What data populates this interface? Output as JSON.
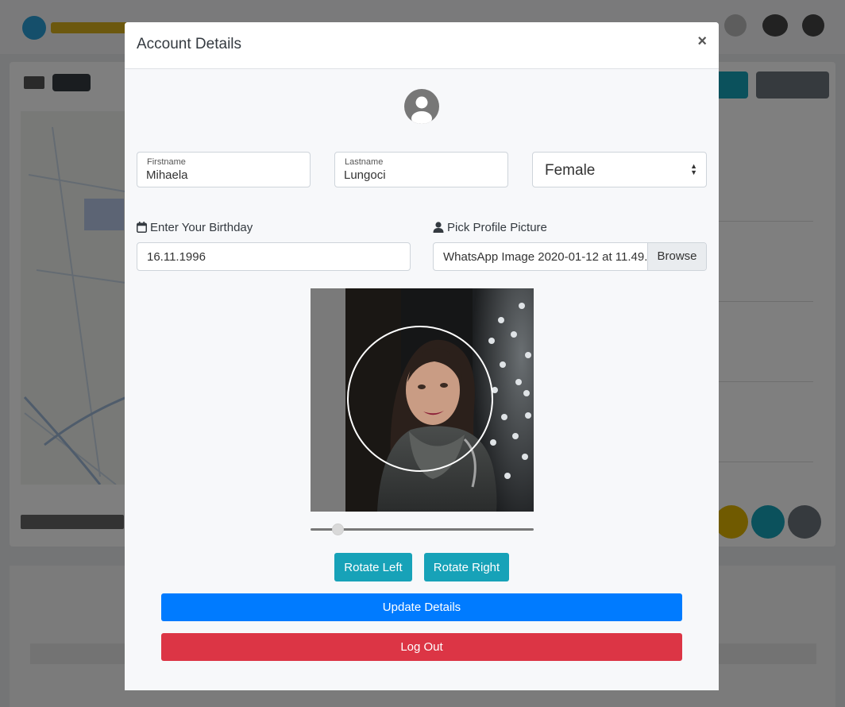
{
  "modal": {
    "title": "Account Details",
    "close_glyph": "×",
    "avatar_icon": "user-circle-icon"
  },
  "form": {
    "firstname": {
      "label": "Firstname",
      "value": "Mihaela"
    },
    "lastname": {
      "label": "Lastname",
      "value": "Lungoci"
    },
    "gender": {
      "selected": "Female"
    },
    "birthday": {
      "label": "Enter Your Birthday",
      "icon": "calendar-icon",
      "value": "16.11.1996"
    },
    "profile_picture": {
      "label": "Pick Profile Picture",
      "icon": "user-icon",
      "file_name": "WhatsApp Image 2020-01-12 at 11.49.0",
      "browse_label": "Browse"
    }
  },
  "cropper": {
    "zoom_level": 0.1
  },
  "actions": {
    "rotate_left": "Rotate Left",
    "rotate_right": "Rotate Right",
    "update": "Update Details",
    "logout": "Log Out"
  },
  "colors": {
    "info": "#17a2b8",
    "primary": "#007bff",
    "danger": "#dc3545",
    "backdrop": "rgba(0,0,0,0.5)"
  }
}
